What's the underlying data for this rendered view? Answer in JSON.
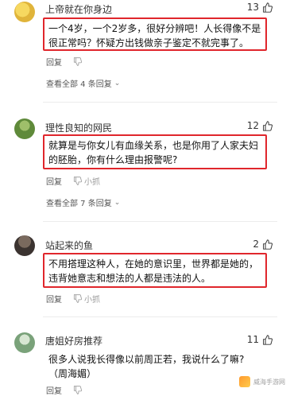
{
  "comments": [
    {
      "username": "上帝就在你身边",
      "likes": "13",
      "text": "一个4岁，一个2岁多，很好分辨吧！人长得像不是很正常吗？怀疑方出钱做亲子鉴定不就完事了。",
      "reply_label": "回复",
      "view_replies": "查看全部 4 条回复"
    },
    {
      "username": "理性良知的网民",
      "likes": "12",
      "text": "就算是与你女儿有血缘关系，也是你用了人家夫妇的胚胎，你有什么理由报警呢?",
      "reply_label": "回复",
      "dislike_count": "小抓",
      "view_replies": "查看全部 7 条回复"
    },
    {
      "username": "站起来的鱼",
      "likes": "2",
      "text": "不用搭理这种人，在她的意识里，世界都是她的，违背她意志和想法的人都是违法的人。",
      "reply_label": "回复",
      "dislike_count": "小抓"
    },
    {
      "username": "唐姐好房推荐",
      "likes": "11",
      "text": "很多人说我长得像以前周正若，我说什么了嘛?（周海媚）",
      "reply_label": "回复"
    }
  ],
  "watermark": "威海手游网"
}
